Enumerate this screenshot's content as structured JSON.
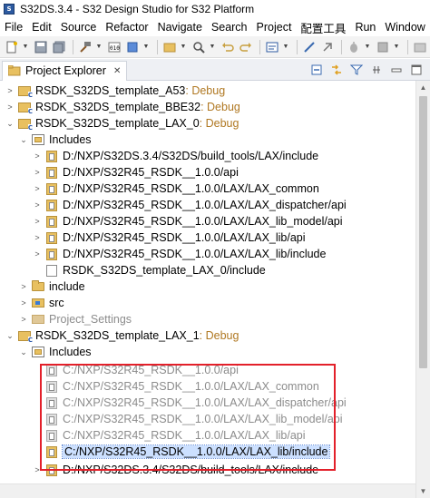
{
  "window": {
    "title": "S32DS.3.4 - S32 Design Studio for S32 Platform"
  },
  "menubar": {
    "items": [
      "File",
      "Edit",
      "Source",
      "Refactor",
      "Navigate",
      "Search",
      "Project",
      "配置工具",
      "Run",
      "Window"
    ]
  },
  "panel": {
    "tab_label": "Project Explorer",
    "close_glyph": "✕"
  },
  "tree": {
    "rows": [
      {
        "label": "RSDK_S32DS_template_A53",
        "deco": ": Debug"
      },
      {
        "label": "RSDK_S32DS_template_BBE32",
        "deco": ": Debug"
      },
      {
        "label": "RSDK_S32DS_template_LAX_0",
        "deco": ": Debug"
      },
      {
        "label": "Includes"
      },
      {
        "label": "D:/NXP/S32DS.3.4/S32DS/build_tools/LAX/include"
      },
      {
        "label": "D:/NXP/S32R45_RSDK__1.0.0/api"
      },
      {
        "label": "D:/NXP/S32R45_RSDK__1.0.0/LAX/LAX_common"
      },
      {
        "label": "D:/NXP/S32R45_RSDK__1.0.0/LAX/LAX_dispatcher/api"
      },
      {
        "label": "D:/NXP/S32R45_RSDK__1.0.0/LAX/LAX_lib_model/api"
      },
      {
        "label": "D:/NXP/S32R45_RSDK__1.0.0/LAX/LAX_lib/api"
      },
      {
        "label": "D:/NXP/S32R45_RSDK__1.0.0/LAX/LAX_lib/include"
      },
      {
        "label": "RSDK_S32DS_template_LAX_0/include"
      },
      {
        "label": "include"
      },
      {
        "label": "src"
      },
      {
        "label": "Project_Settings"
      },
      {
        "label": "RSDK_S32DS_template_LAX_1",
        "deco": ": Debug"
      },
      {
        "label": "Includes"
      },
      {
        "label": "C:/NXP/S32R45_RSDK__1.0.0/api"
      },
      {
        "label": "C:/NXP/S32R45_RSDK__1.0.0/LAX/LAX_common"
      },
      {
        "label": "C:/NXP/S32R45_RSDK__1.0.0/LAX/LAX_dispatcher/api"
      },
      {
        "label": "C:/NXP/S32R45_RSDK__1.0.0/LAX/LAX_lib_model/api"
      },
      {
        "label": "C:/NXP/S32R45_RSDK__1.0.0/LAX/LAX_lib/api"
      },
      {
        "label": "C:/NXP/S32R45_RSDK__1.0.0/LAX/LAX_lib/include"
      },
      {
        "label": "D:/NXP/S32DS.3.4/S32DS/build_tools/LAX/include"
      }
    ]
  },
  "colors": {
    "highlight_box": "#e3202a",
    "selection": "#cce0ff",
    "deco_text": "#b07822",
    "inactive_text": "#8c8c8c"
  }
}
